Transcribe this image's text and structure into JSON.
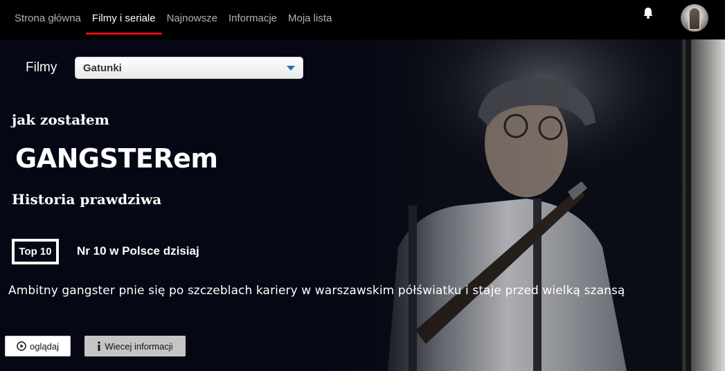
{
  "nav": {
    "items": [
      {
        "label": "Strona główna",
        "active": false
      },
      {
        "label": "Filmy i seriale",
        "active": true
      },
      {
        "label": "Najnowsze",
        "active": false
      },
      {
        "label": "Informacje",
        "active": false
      },
      {
        "label": "Moja lista",
        "active": false
      }
    ],
    "accent_color": "#e50914",
    "notification_icon": "bell-icon",
    "avatar_icon": "user-avatar"
  },
  "filter": {
    "label": "Filmy",
    "select_value": "Gatunki"
  },
  "hero": {
    "title_line1": "jak zostałem",
    "title_line2": "GANGSTERem",
    "title_line3": "Historia prawdziwa",
    "badge": "Top 10",
    "rank_text": "Nr 10 w Polsce dzisiaj",
    "synopsis": "Ambitny gangster pnie się po szczeblach kariery w warszawskim półświatku i staje przed wielką szansą",
    "play_label": "oglądaj",
    "info_label": "Wiecej informacji"
  }
}
